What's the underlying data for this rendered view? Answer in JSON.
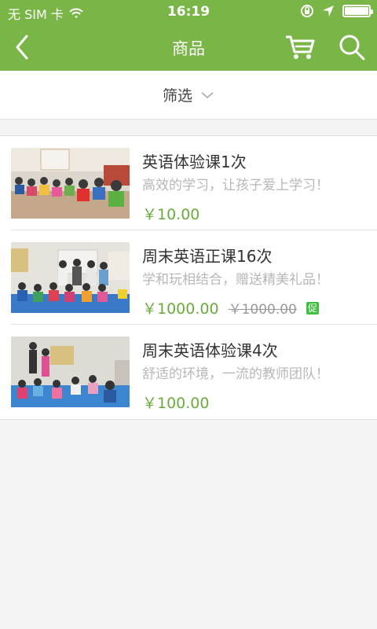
{
  "status_bar": {
    "carrier": "无 SIM 卡",
    "time": "16:19"
  },
  "nav": {
    "title": "商品",
    "icons": [
      "back-icon",
      "cart-icon",
      "search-icon"
    ]
  },
  "filter": {
    "label": "筛选",
    "icon": "chevron-down-icon"
  },
  "products": [
    {
      "name": "英语体验课1次",
      "description": "高效的学习，让孩子爱上学习！",
      "price": "￥10.00"
    },
    {
      "name": "周末英语正课16次",
      "description": "学和玩相结合，赠送精美礼品！",
      "price": "￥1000.00",
      "original_price": "￥1000.00",
      "promo_badge": "促"
    },
    {
      "name": "周末英语体验课4次",
      "description": "舒适的环境，一流的教师团队！",
      "price": "￥100.00"
    }
  ],
  "colors": {
    "brand_green": "#7ab547",
    "price_green": "#6aac3c",
    "promo_green": "#3fbf3f"
  }
}
